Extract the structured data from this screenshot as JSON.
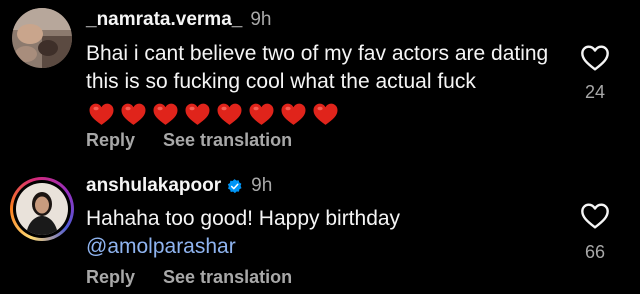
{
  "comments": [
    {
      "username": "_namrata.verma_",
      "time": "9h",
      "verified": false,
      "text": "Bhai i cant believe two of my fav actors are dating this is so fucking cool what the actual fuck",
      "emoji": [
        "❤️",
        "❤️",
        "❤️",
        "❤️",
        "❤️",
        "❤️",
        "❤️",
        "❤️"
      ],
      "actions": [
        "Reply",
        "See translation"
      ],
      "likes": "24"
    },
    {
      "username": "anshulakapoor",
      "time": "9h",
      "verified": true,
      "text": "Hahaha too good! Happy birthday",
      "mention": "@amolparashar",
      "actions": [
        "Reply",
        "See translation"
      ],
      "likes": "66"
    }
  ],
  "colors": {
    "background": "#000000",
    "text": "#f5f5f5",
    "muted": "#a8a8a8",
    "mention": "#8fb4f0",
    "verified": "#0095f6",
    "heart_emoji": "#e0241b"
  },
  "icons": {
    "like": "heart-outline-icon",
    "verified": "verified-badge-icon",
    "emoji": "red-heart-emoji"
  }
}
